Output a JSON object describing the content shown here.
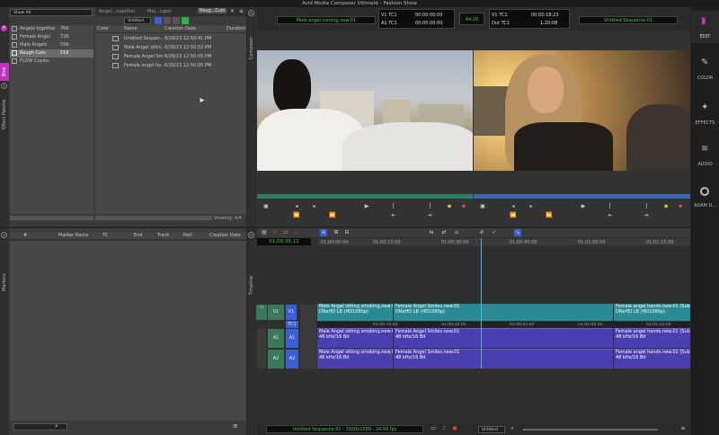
{
  "window_title": "Avid Media Composer Ultimate - Fashion Show",
  "bin": {
    "tabs": [
      "Angel...together",
      "Mal...ngels",
      "Roug...Cuts"
    ],
    "show_all": "Show All",
    "view_select": "Untitled",
    "left_items": [
      {
        "name": "Angels together",
        "size": "76K"
      },
      {
        "name": "Female Angel",
        "size": "72K"
      },
      {
        "name": "Male Angels",
        "size": "55K"
      },
      {
        "name": "Rough Cuts",
        "size": "51K"
      },
      {
        "name": "FLOW Copies",
        "size": ""
      }
    ],
    "columns": [
      "Color",
      "Name",
      "Creation Date",
      "Duration"
    ],
    "rows": [
      {
        "name": "Untitled Sequen...",
        "date": "6/29/23 12:50:41 PM"
      },
      {
        "name": "Male Angel sittin...",
        "date": "6/29/23 12:50:52 PM"
      },
      {
        "name": "Female Angel Sm...",
        "date": "6/29/23 12:50:05 PM"
      },
      {
        "name": "Female angel ha...",
        "date": "6/29/23 12:50:05 PM"
      }
    ],
    "viewing": "Viewing: 4/4",
    "side_tabs": [
      "Bins",
      "Effect Palette"
    ]
  },
  "markers": {
    "side_label": "Markers",
    "columns": [
      "#",
      "Marker Name",
      "TC",
      "End",
      "Track",
      "Part",
      "Creation Date"
    ]
  },
  "composer": {
    "side_label": "Composer",
    "source_name": "Male angel turning.new.01",
    "record_name": "Untitled Sequence.01",
    "tc_rows": [
      {
        "label": "V1 TC1",
        "value": "00:00:00:00"
      },
      {
        "label": "A1 TC1",
        "value": "00:00:00:00"
      }
    ],
    "center_tc": "44:20",
    "rec_rows": [
      {
        "label": "V1 TC1",
        "value": "00:00:18:23"
      },
      {
        "label": "Out TC1",
        "value": "1:20:08"
      }
    ]
  },
  "timeline": {
    "side_label": "Timeline",
    "current_tc": "01:00:35:12",
    "ruler": [
      "01:00:00:00",
      "01:00:15:00",
      "01:00:30:00",
      "01:00:45:00",
      "01:01:00:00",
      "01:01:15:00"
    ],
    "video_track": "V1",
    "tc_track": "TC1",
    "audio_tracks": [
      "A1",
      "A2"
    ],
    "video_clips": [
      {
        "title": "Male Angel sitting smoking.new.01",
        "fmt": "DNxHD LB (HD1080p)"
      },
      {
        "title": "Female Angel Smiles.new.01",
        "fmt": "DNxHD LB (HD1080p)"
      },
      {
        "title": "Female angel hands.new.01 (Subc",
        "fmt": "DNxHD LB (HD1080p)"
      }
    ],
    "tc_ticks": [
      "01:00:15:00",
      "01:00:30:00",
      "01:00:45:00",
      "01:01:00:00",
      "01:01:15:00"
    ],
    "audio_clips": [
      {
        "title": "Male Angel sitting smoking.new.01",
        "fmt": "48 kHz/16 Bit"
      },
      {
        "title": "Female Angel Smiles.new.01",
        "fmt": "48 kHz/16 Bit"
      },
      {
        "title": "Female angel hands.new.01 (Subc",
        "fmt": "48 kHz/16 Bit"
      }
    ],
    "bottom_label": "Untitled Sequence.01 - 1920x1080 - 24.00 fps",
    "bottom_select": "Untitled"
  },
  "toolbar": {
    "items": [
      {
        "label": "EDIT",
        "icon": "edit-icon"
      },
      {
        "label": "COLOR",
        "icon": "color-icon"
      },
      {
        "label": "EFFECTS",
        "icon": "effects-icon"
      },
      {
        "label": "AUDIO",
        "icon": "audio-icon"
      },
      {
        "label": "ADAM D...",
        "icon": "user-icon"
      }
    ]
  },
  "colors": {
    "accent": "#c033c0",
    "video_clip": "#2a8a96",
    "audio_clip": "#4a3fb0",
    "track_green": "#3a7a5a",
    "tc_green": "#4fc24f"
  }
}
